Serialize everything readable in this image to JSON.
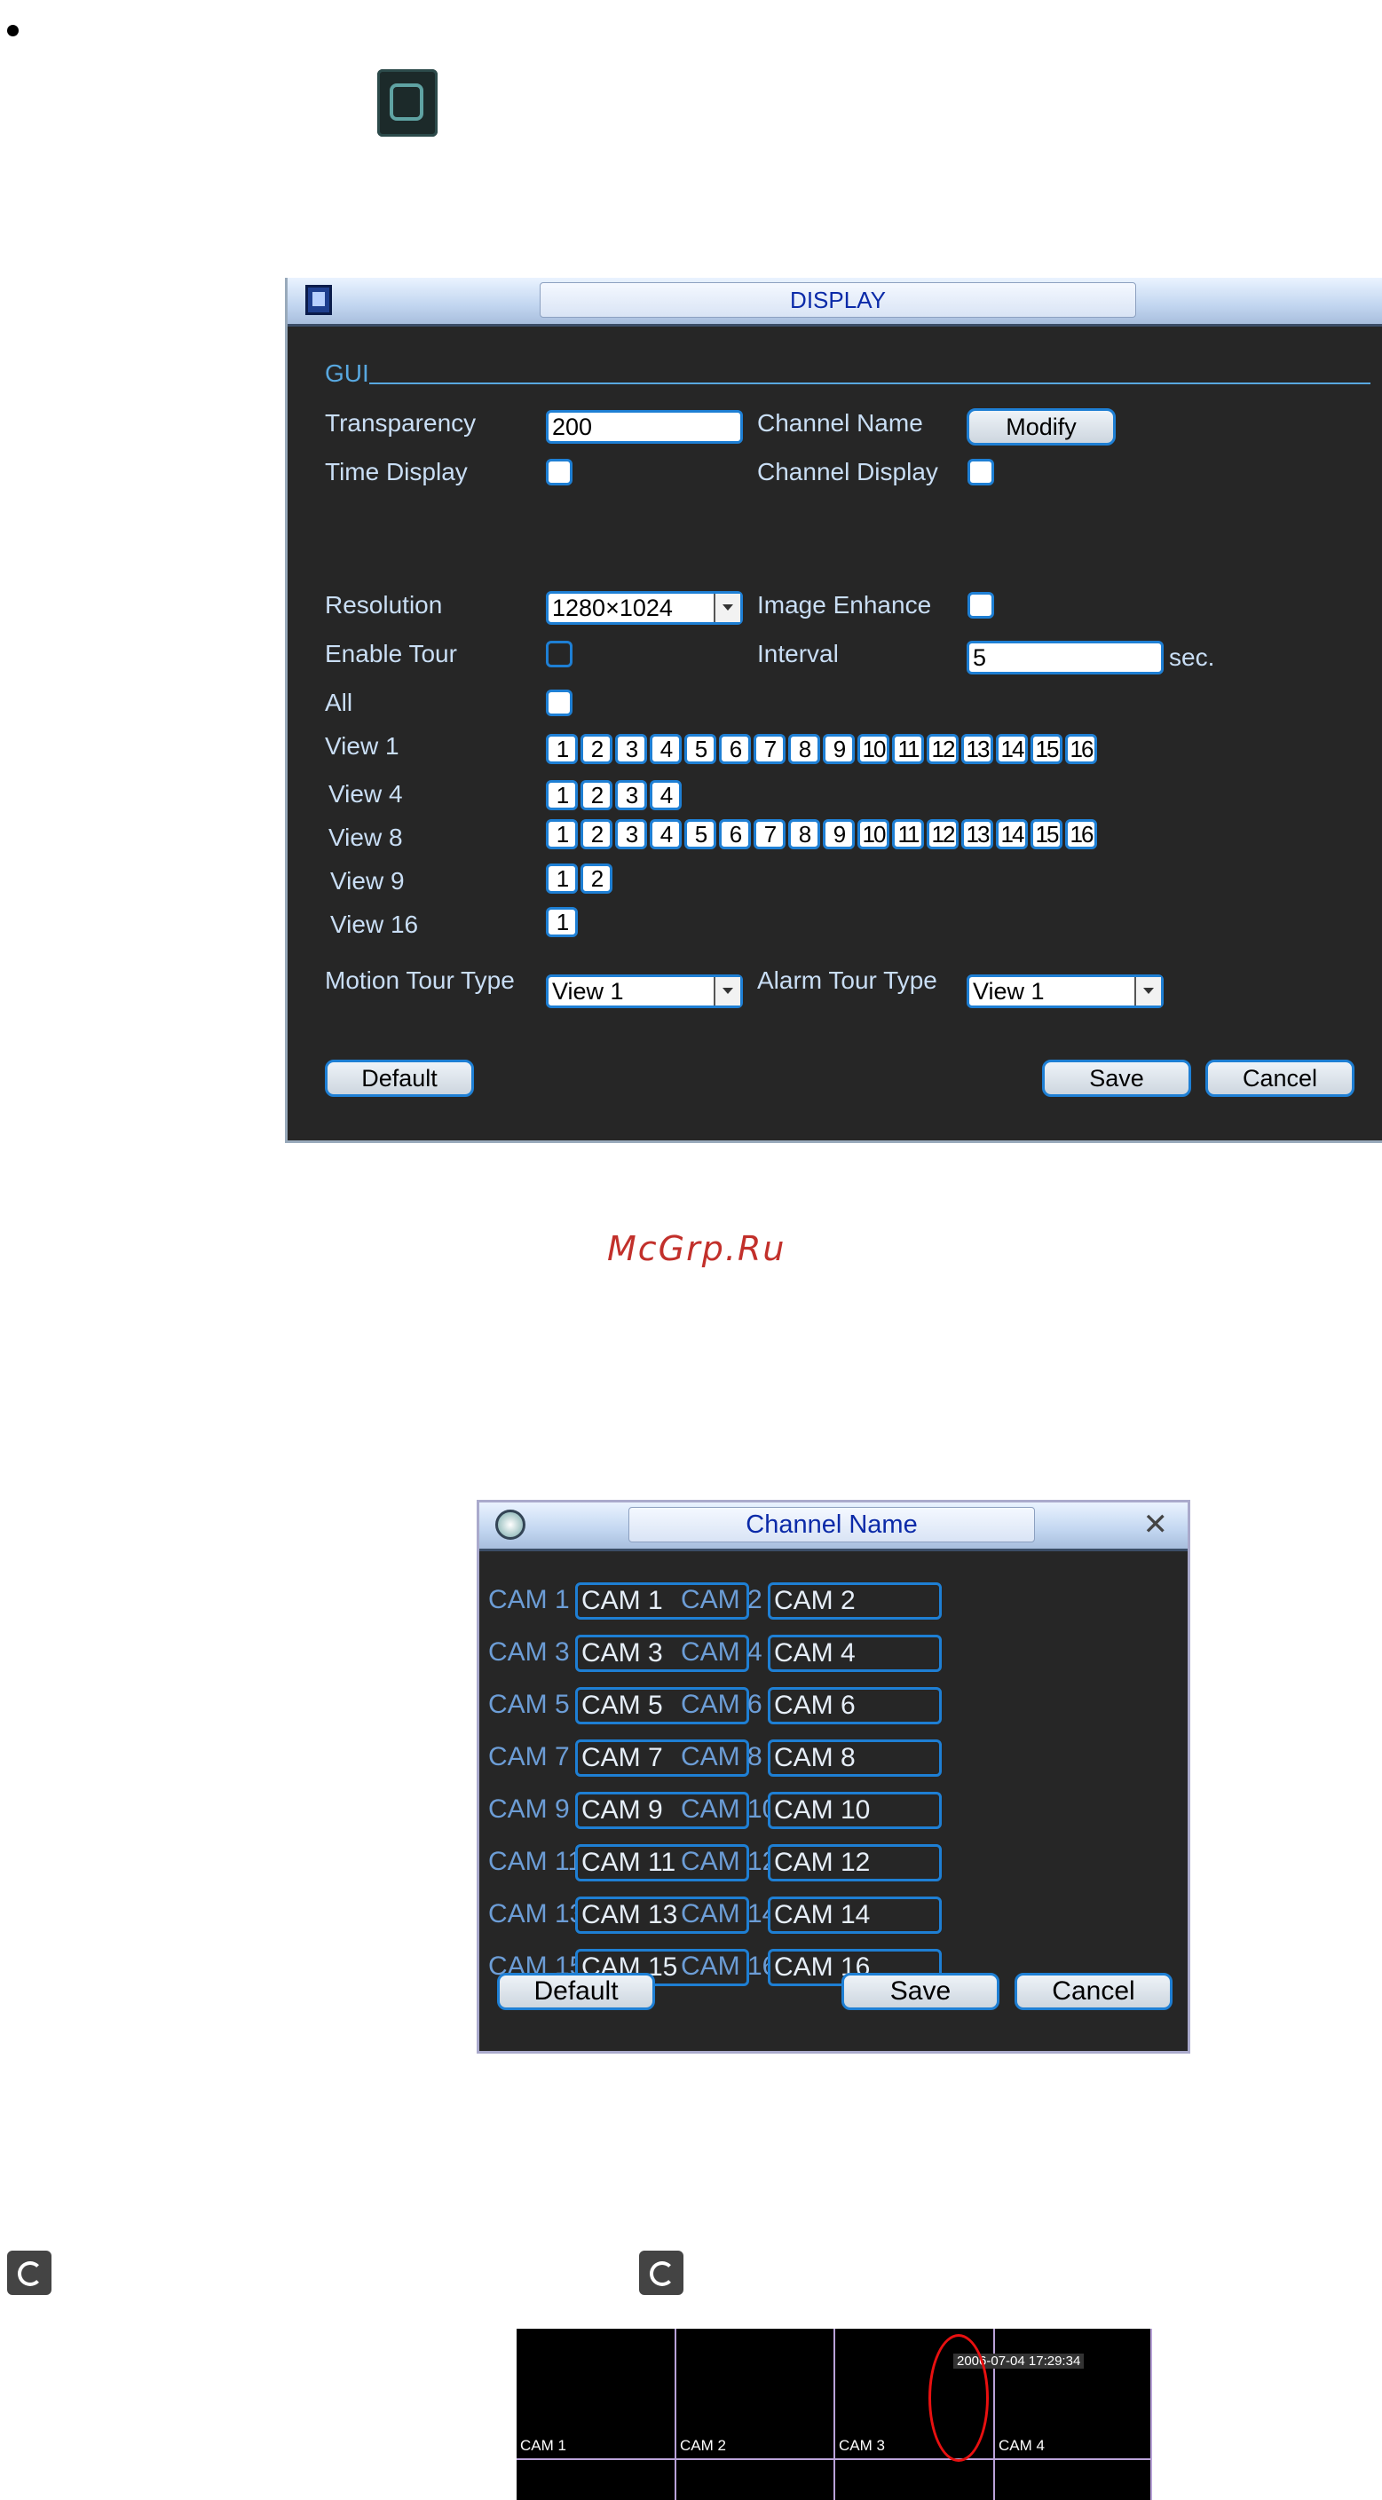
{
  "display": {
    "title": "DISPLAY",
    "section_gui": "GUI",
    "transparency_label": "Transparency",
    "transparency_value": "200",
    "channel_name_label": "Channel Name",
    "modify_btn": "Modify",
    "time_display_label": "Time Display",
    "channel_display_label": "Channel Display",
    "resolution_label": "Resolution",
    "resolution_value": "1280×1024",
    "image_enhance_label": "Image Enhance",
    "enable_tour_label": "Enable Tour",
    "interval_label": "Interval",
    "interval_value": "5",
    "interval_unit": "sec.",
    "all_label": "All",
    "view1_label": "View 1",
    "view4_label": "View 4",
    "view8_label": "View 8",
    "view9_label": "View 9",
    "view16_label": "View 16",
    "view1_nums": [
      "1",
      "2",
      "3",
      "4",
      "5",
      "6",
      "7",
      "8",
      "9",
      "10",
      "11",
      "12",
      "13",
      "14",
      "15",
      "16"
    ],
    "view4_nums": [
      "1",
      "2",
      "3",
      "4"
    ],
    "view8_nums": [
      "1",
      "2",
      "3",
      "4",
      "5",
      "6",
      "7",
      "8",
      "9",
      "10",
      "11",
      "12",
      "13",
      "14",
      "15",
      "16"
    ],
    "view9_nums": [
      "1",
      "2"
    ],
    "view16_nums": [
      "1"
    ],
    "motion_tour_label": "Motion Tour Type",
    "motion_tour_value": "View 1",
    "alarm_tour_label": "Alarm Tour Type",
    "alarm_tour_value": "View 1",
    "default_btn": "Default",
    "save_btn": "Save",
    "cancel_btn": "Cancel"
  },
  "watermark": "McGrp.Ru",
  "channel_name": {
    "title": "Channel Name",
    "close": "✕",
    "rows": [
      [
        "CAM 1",
        "CAM 1",
        "CAM 2",
        "CAM 2"
      ],
      [
        "CAM 3",
        "CAM 3",
        "CAM 4",
        "CAM 4"
      ],
      [
        "CAM 5",
        "CAM 5",
        "CAM 6",
        "CAM 6"
      ],
      [
        "CAM 7",
        "CAM 7",
        "CAM 8",
        "CAM 8"
      ],
      [
        "CAM 9",
        "CAM 9",
        "CAM 10",
        "CAM 10"
      ],
      [
        "CAM 11",
        "CAM 11",
        "CAM 12",
        "CAM 12"
      ],
      [
        "CAM 13",
        "CAM 13",
        "CAM 14",
        "CAM 14"
      ],
      [
        "CAM 15",
        "CAM 15",
        "CAM 16",
        "CAM 16"
      ]
    ],
    "default_btn": "Default",
    "save_btn": "Save",
    "cancel_btn": "Cancel"
  },
  "grid": {
    "labels": [
      "CAM 1",
      "CAM 2",
      "CAM 3",
      "CAM 4"
    ],
    "timestamp": "2006-07-04 17:29:34"
  }
}
